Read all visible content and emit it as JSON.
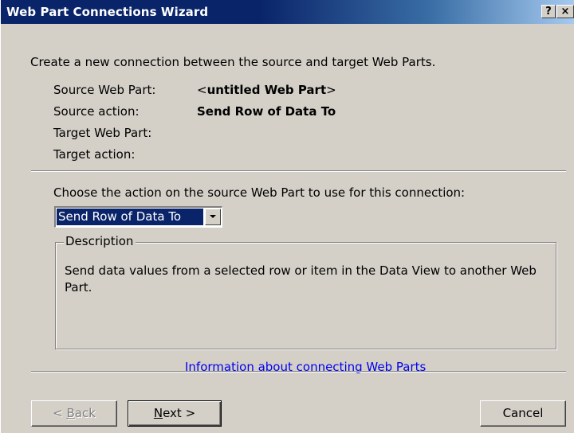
{
  "window": {
    "title": "Web Part Connections Wizard",
    "help_label": "?",
    "close_label": "×"
  },
  "intro": "Create a new connection between the source and target Web Parts.",
  "fields": [
    {
      "label": "Source Web Part:",
      "value": "<untitled Web Part>"
    },
    {
      "label": "Source action:",
      "value": "Send Row of Data To"
    },
    {
      "label": "Target Web Part:",
      "value": ""
    },
    {
      "label": "Target action:",
      "value": ""
    }
  ],
  "choose_label": "Choose the action on the source Web Part to use for this connection:",
  "action_select": {
    "selected": "Send Row of Data To"
  },
  "description": {
    "legend": "Description",
    "text": "Send data values from a selected row or item in the Data View to another Web Part."
  },
  "help_link": "Information about connecting Web Parts",
  "buttons": {
    "back": {
      "pre": "< ",
      "accel": "B",
      "post": "ack"
    },
    "next": {
      "accel": "N",
      "post": "ext >"
    },
    "cancel": "Cancel"
  },
  "colors": {
    "titlebar": "#0a246a",
    "dialog_bg": "#d4d0c8",
    "selection": "#0a246a",
    "link": "#0000ee"
  }
}
